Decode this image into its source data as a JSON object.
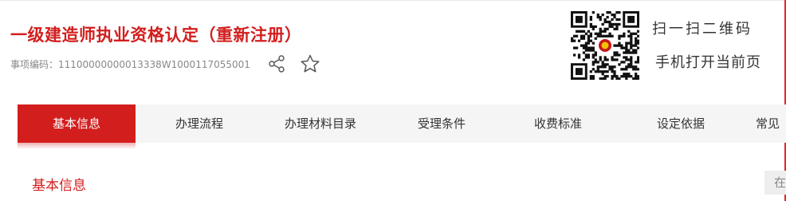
{
  "header": {
    "title": "一级建造师执业资格认定（重新注册）",
    "item_code": "事项编码：11100000000013338W1000117055001"
  },
  "qr": {
    "scan_label": "扫一扫二维码",
    "open_label": "手机打开当前页"
  },
  "tabs": [
    {
      "label": "基本信息",
      "active": true
    },
    {
      "label": "办理流程"
    },
    {
      "label": "办理材料目录"
    },
    {
      "label": "受理条件"
    },
    {
      "label": "收费标准"
    },
    {
      "label": "设定依据"
    },
    {
      "label": "常见"
    }
  ],
  "section": {
    "title": "基本信息",
    "side_button": "在"
  },
  "icons": {
    "share": "share-icon",
    "favorite": "star-outline-icon"
  },
  "colors": {
    "accent": "#d31e1e",
    "tabbar_bg": "#f5f5f5"
  }
}
